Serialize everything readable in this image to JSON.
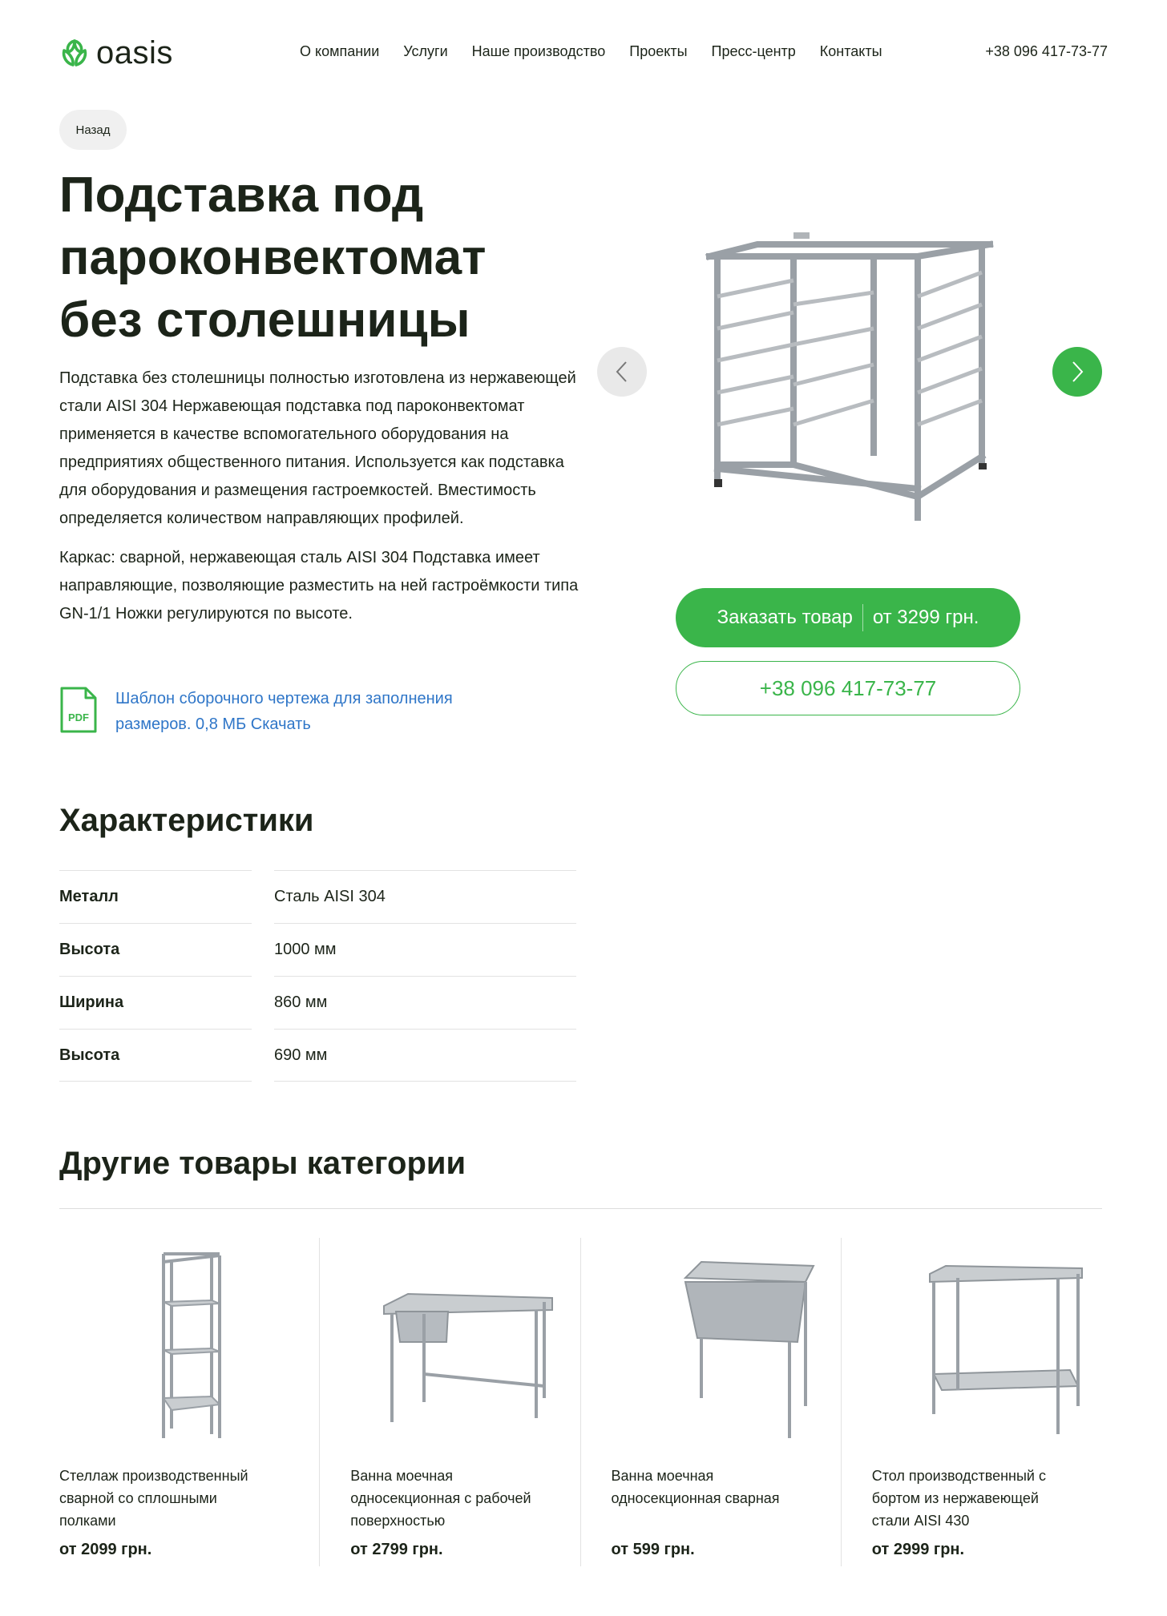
{
  "header": {
    "logo_text": "oasis",
    "nav": [
      "О компании",
      "Услуги",
      "Наше производство",
      "Проекты",
      "Пресс-центр",
      "Контакты"
    ],
    "phone": "+38 096 417-73-77"
  },
  "back_label": "Назад",
  "product": {
    "title": "Подставка под пароконвектомат без столешницы",
    "description_1": "Подставка без столешницы полностью изготовлена из нержавеющей стали AISI 304 Нержавеющая подставка под пароконвектомат применяется в качестве вспомогательного оборудования на предприятиях общественного питания. Используется как подставка для оборудования и размещения гастроемкостей. Вместимость определяется количеством направляющих профилей.",
    "description_2": "Каркас: сварной, нержавеющая сталь AISI 304 Подставка имеет направляющие, позволяющие разместить на ней гастроёмкости типа GN-1/1 Ножки регулируются по высоте.",
    "pdf_icon_label": "PDF",
    "pdf_link": "Шаблон сборочного чертежа для заполнения размеров. 0,8 МБ Скачать",
    "order_label": "Заказать товар",
    "order_price": "от 3299 грн.",
    "phone_button": "+38 096 417-73-77"
  },
  "specs": {
    "title": "Характеристики",
    "rows": [
      {
        "k": "Металл",
        "v": "Сталь AISI 304"
      },
      {
        "k": "Высота",
        "v": "1000 мм"
      },
      {
        "k": "Ширина",
        "v": "860 мм"
      },
      {
        "k": "Высота",
        "v": "690 мм"
      }
    ]
  },
  "related": {
    "title": "Другие товары категории",
    "items": [
      {
        "title": "Стеллаж производственный сварной со сплошными полками",
        "price": "от 2099 грн."
      },
      {
        "title": "Ванна моечная односекционная с рабочей поверхностью",
        "price": "от 2799 грн."
      },
      {
        "title": "Ванна моечная односекционная сварная",
        "price": "от 599 грн."
      },
      {
        "title": "Стол производственный с бортом из нержавеющей стали AISI 430",
        "price": "от 2999 грн."
      }
    ]
  },
  "colors": {
    "accent": "#3ab54a",
    "link": "#2f76c8",
    "text": "#1c2419"
  }
}
